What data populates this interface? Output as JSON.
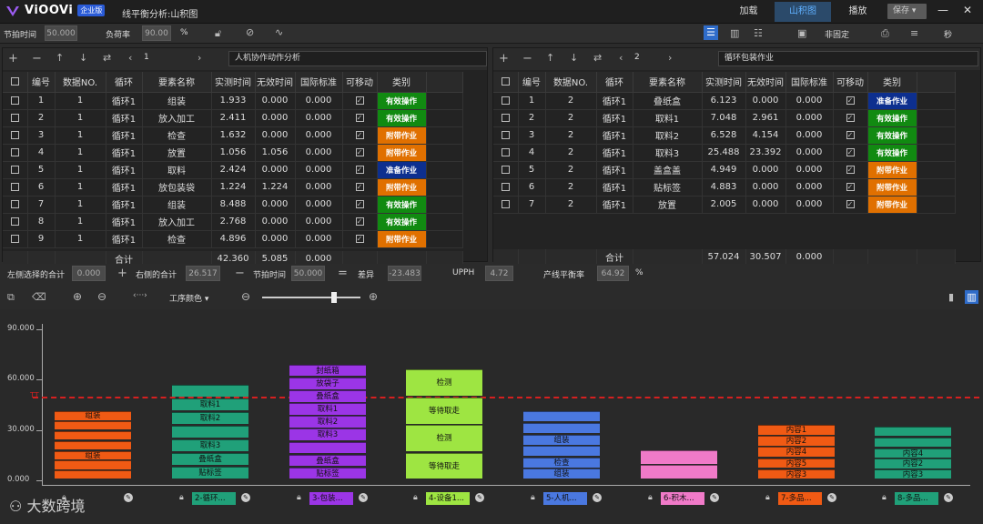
{
  "app": {
    "brand": "ViOOVi",
    "edition": "企业版",
    "title": "线平衡分析:山积图"
  },
  "tabs": [
    "加载",
    "山积图",
    "播放"
  ],
  "save_label": "保存",
  "toolbar": {
    "takt_label": "节拍时间",
    "takt_value": "50.000",
    "load_label": "负荷率",
    "load_value": "90.00",
    "load_unit": "%",
    "fixed_label": "非固定",
    "unit_label": "秒"
  },
  "left_panel": {
    "page": "1",
    "name": "人机协作动作分析",
    "headers": [
      "编号",
      "数据NO.",
      "循环",
      "要素名称",
      "实测时间",
      "无效时间",
      "国际标准",
      "可移动",
      "类别"
    ],
    "rows": [
      [
        "1",
        "1",
        "循环1",
        "组装",
        "1.933",
        "0.000",
        "0.000",
        "有效操作"
      ],
      [
        "2",
        "1",
        "循环1",
        "放入加工",
        "2.411",
        "0.000",
        "0.000",
        "有效操作"
      ],
      [
        "3",
        "1",
        "循环1",
        "检查",
        "1.632",
        "0.000",
        "0.000",
        "附带作业"
      ],
      [
        "4",
        "1",
        "循环1",
        "放置",
        "1.056",
        "1.056",
        "0.000",
        "附带作业"
      ],
      [
        "5",
        "1",
        "循环1",
        "取料",
        "2.424",
        "0.000",
        "0.000",
        "准备作业"
      ],
      [
        "6",
        "1",
        "循环1",
        "放包装袋",
        "1.224",
        "1.224",
        "0.000",
        "附带作业"
      ],
      [
        "7",
        "1",
        "循环1",
        "组装",
        "8.488",
        "0.000",
        "0.000",
        "有效操作"
      ],
      [
        "8",
        "1",
        "循环1",
        "放入加工",
        "2.768",
        "0.000",
        "0.000",
        "有效操作"
      ],
      [
        "9",
        "1",
        "循环1",
        "检查",
        "4.896",
        "0.000",
        "0.000",
        "附带作业"
      ]
    ],
    "sum_label": "合计",
    "sum": [
      "42.360",
      "5.085",
      "0.000"
    ]
  },
  "right_panel": {
    "page": "2",
    "name": "循环包装作业",
    "headers": [
      "编号",
      "数据NO.",
      "循环",
      "要素名称",
      "实测时间",
      "无效时间",
      "国际标准",
      "可移动",
      "类别"
    ],
    "rows": [
      [
        "1",
        "2",
        "循环1",
        "叠纸盒",
        "6.123",
        "0.000",
        "0.000",
        "准备作业"
      ],
      [
        "2",
        "2",
        "循环1",
        "取料1",
        "7.048",
        "2.961",
        "0.000",
        "有效操作"
      ],
      [
        "3",
        "2",
        "循环1",
        "取料2",
        "6.528",
        "4.154",
        "0.000",
        "有效操作"
      ],
      [
        "4",
        "2",
        "循环1",
        "取料3",
        "25.488",
        "23.392",
        "0.000",
        "有效操作"
      ],
      [
        "5",
        "2",
        "循环1",
        "盖盒盖",
        "4.949",
        "0.000",
        "0.000",
        "附带作业"
      ],
      [
        "6",
        "2",
        "循环1",
        "贴标签",
        "4.883",
        "0.000",
        "0.000",
        "附带作业"
      ],
      [
        "7",
        "2",
        "循环1",
        "放置",
        "2.005",
        "0.000",
        "0.000",
        "附带作业"
      ]
    ],
    "sum_label": "合计",
    "sum": [
      "57.024",
      "30.507",
      "0.000"
    ]
  },
  "type_colors": {
    "有效操作": "#118a11",
    "附带作业": "#e07000",
    "准备作业": "#0d2f8f"
  },
  "status": {
    "left_sum_label": "左侧选择的合计",
    "left_sum": "0.000",
    "right_sum_label": "右侧的合计",
    "right_sum": "26.517",
    "takt_label": "节拍时间",
    "takt": "50.000",
    "diff_label": "差异",
    "diff": "-23.483",
    "upph_label": "UPPH",
    "upph": "4.72",
    "balance_label": "产线平衡率",
    "balance": "64.92",
    "balance_unit": "%"
  },
  "chart_tool": {
    "color_label": "工序颜色"
  },
  "chart_data": {
    "type": "bar",
    "stacked": true,
    "ylim": [
      0,
      90
    ],
    "yticks": [
      "90.000",
      "60.000",
      "30.000",
      "0.000"
    ],
    "takt_marker": "TT",
    "takt_line": 50,
    "columns": [
      {
        "label": "",
        "color": "#f05a14",
        "total": 41,
        "segments": [
          "组装",
          "",
          "",
          "",
          "组装",
          "",
          ""
        ]
      },
      {
        "label": "2-循环...",
        "color": "#20a079",
        "total": 57,
        "segments": [
          "",
          "取料1",
          "取料2",
          "",
          "取料3",
          "叠纸盒",
          "贴标签"
        ]
      },
      {
        "label": "3-包装...",
        "color": "#9b35e6",
        "total": 69,
        "segments": [
          "封纸箱",
          "放袋子",
          "叠纸盒",
          "取料1",
          "取料2",
          "取料3",
          "",
          "叠纸盒",
          "贴标签"
        ]
      },
      {
        "label": "4-设备1...",
        "color": "#9ee542",
        "total": 66,
        "segments": [
          "检测",
          "等待取走",
          "检测",
          "等待取走"
        ]
      },
      {
        "label": "5-人机...",
        "color": "#4a78e0",
        "total": 41,
        "segments": [
          "",
          "",
          "组装",
          "",
          "检查",
          "组装"
        ]
      },
      {
        "label": "6-积木...",
        "color": "#f07ac8",
        "total": 18,
        "segments": [
          "",
          ""
        ]
      },
      {
        "label": "7-多品...",
        "color": "#f05a14",
        "total": 33,
        "segments": [
          "内容1",
          "内容2",
          "内容4",
          "内容5",
          "内容3"
        ]
      },
      {
        "label": "8-多品...",
        "color": "#20a079",
        "total": 32,
        "segments": [
          "",
          "",
          "内容4",
          "内容2",
          "内容3"
        ]
      }
    ]
  },
  "watermark": "大数跨境"
}
